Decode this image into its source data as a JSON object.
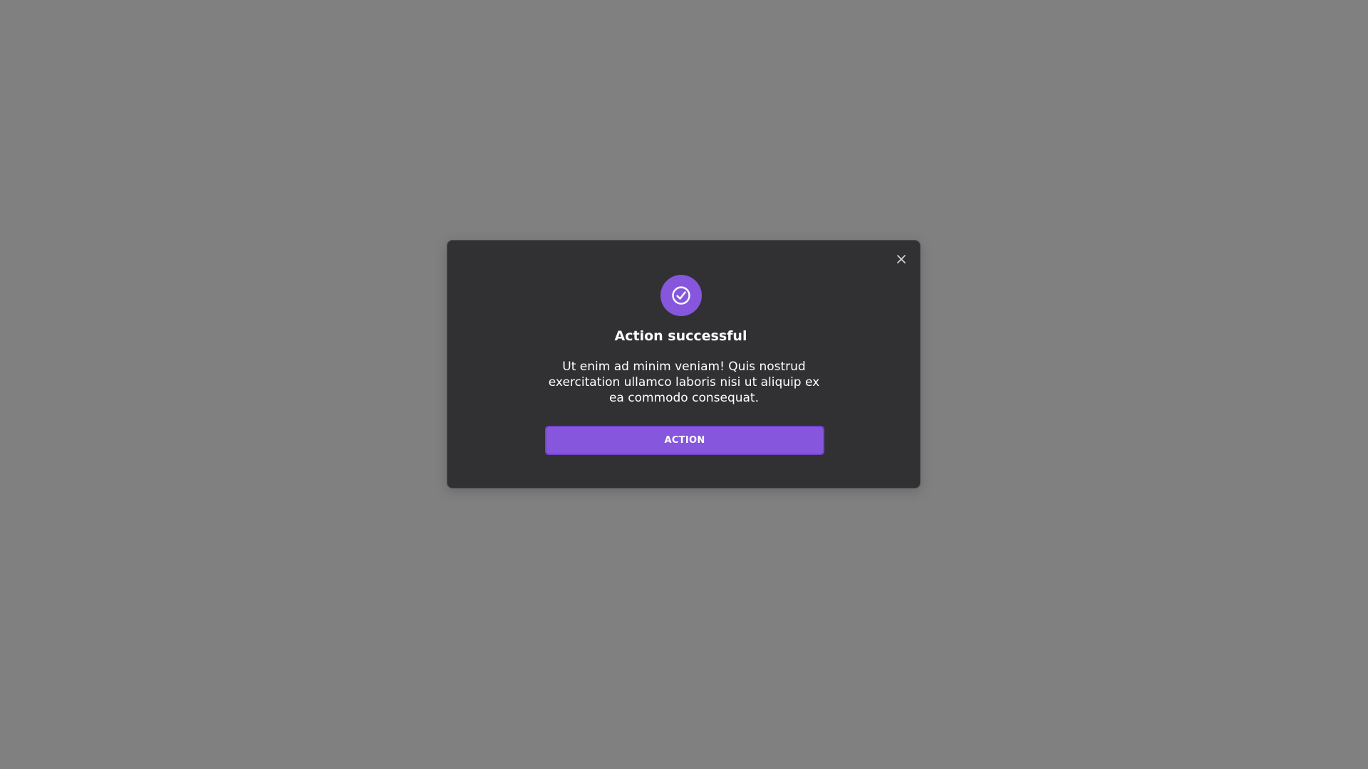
{
  "modal": {
    "icon": "check-circle-icon",
    "close_icon": "close-icon",
    "title": "Action successful",
    "message": "Ut enim ad minim veniam! Quis nostrud exercitation ullamco laboris nisi ut aliquip ex ea commodo consequat.",
    "action_label": "ACTION"
  },
  "colors": {
    "backdrop": "#808080",
    "modal_background": "#313033",
    "accent": "#8656dc",
    "text": "#ffffff"
  }
}
